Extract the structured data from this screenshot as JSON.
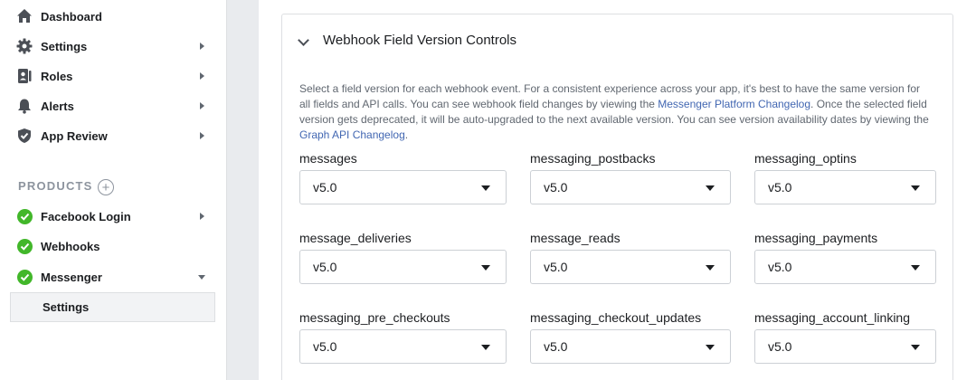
{
  "sidebar": {
    "items": [
      {
        "label": "Dashboard",
        "icon": "home-icon"
      },
      {
        "label": "Settings",
        "icon": "gear-icon"
      },
      {
        "label": "Roles",
        "icon": "roles-icon"
      },
      {
        "label": "Alerts",
        "icon": "bell-icon"
      },
      {
        "label": "App Review",
        "icon": "shield-icon"
      }
    ],
    "products_header": "PRODUCTS",
    "products": [
      {
        "label": "Facebook Login",
        "icon": "check-circle-icon"
      },
      {
        "label": "Webhooks",
        "icon": "check-circle-icon"
      },
      {
        "label": "Messenger",
        "icon": "check-circle-icon"
      }
    ],
    "active_subitem": "Settings"
  },
  "panel": {
    "title": "Webhook Field Version Controls",
    "description": {
      "part1": "Select a field version for each webhook event. For a consistent experience across your app, it's best to have the same version for all fields and API calls. You can see webhook field changes by viewing the ",
      "link1": "Messenger Platform Changelog",
      "part2": ". Once the selected field version gets deprecated, it will be auto-upgraded to the next available version. You can see version availability dates by viewing the ",
      "link2": "Graph API Changelog",
      "part3": "."
    },
    "fields": [
      {
        "label": "messages",
        "value": "v5.0"
      },
      {
        "label": "messaging_postbacks",
        "value": "v5.0"
      },
      {
        "label": "messaging_optins",
        "value": "v5.0"
      },
      {
        "label": "message_deliveries",
        "value": "v5.0"
      },
      {
        "label": "message_reads",
        "value": "v5.0"
      },
      {
        "label": "messaging_payments",
        "value": "v5.0"
      },
      {
        "label": "messaging_pre_checkouts",
        "value": "v5.0"
      },
      {
        "label": "messaging_checkout_updates",
        "value": "v5.0"
      },
      {
        "label": "messaging_account_linking",
        "value": "v5.0"
      }
    ]
  },
  "colors": {
    "accent": "#4267b2",
    "success": "#42b72a"
  }
}
